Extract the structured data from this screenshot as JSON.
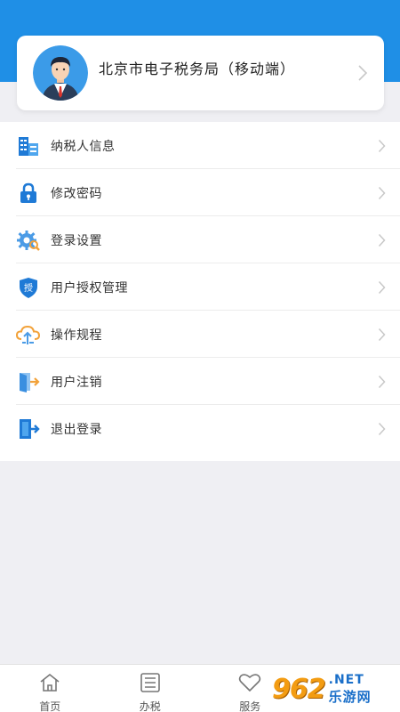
{
  "header": {
    "accent_color": "#1f8fe6",
    "profile": {
      "name": "北京市电子税务局（移动端）",
      "avatar_icon": "user-avatar-icon"
    }
  },
  "menu": {
    "items": [
      {
        "label": "纳税人信息",
        "icon": "building-icon"
      },
      {
        "label": "修改密码",
        "icon": "lock-icon"
      },
      {
        "label": "登录设置",
        "icon": "gear-icon"
      },
      {
        "label": "用户授权管理",
        "icon": "authorize-shield-icon",
        "icon_text": "授"
      },
      {
        "label": "操作规程",
        "icon": "cloud-upload-icon"
      },
      {
        "label": "用户注销",
        "icon": "door-exit-icon"
      },
      {
        "label": "退出登录",
        "icon": "logout-icon"
      }
    ]
  },
  "tabbar": {
    "tabs": [
      {
        "label": "首页",
        "icon": "home-icon"
      },
      {
        "label": "办税",
        "icon": "list-icon"
      },
      {
        "label": "服务",
        "icon": "heart-icon"
      }
    ]
  },
  "watermark": {
    "number": "962",
    "suffix": ".NET",
    "cn": "乐游网"
  }
}
